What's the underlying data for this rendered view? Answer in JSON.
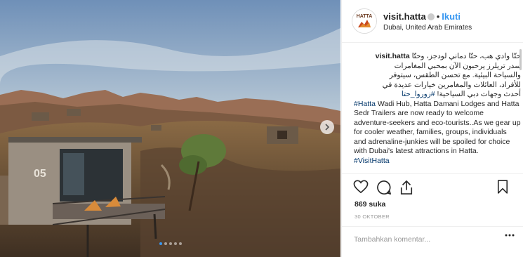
{
  "photo": {
    "alt_icon": "photo-carousel",
    "sign_number": "05",
    "dots_count": 5,
    "active_dot": 0
  },
  "header": {
    "username": "visit.hatta",
    "separator": "•",
    "follow_label": "Ikuti",
    "location": "Dubai, United Arab Emirates",
    "avatar_text": "HATTA"
  },
  "caption": {
    "username": "visit.hatta",
    "arabic_line1": "حتّا وادي هب، حتّا دماني لودجز، وحتّا",
    "arabic_line2": "سدر تريلرز يرحبون الآن بمحبي المغامرات",
    "arabic_line3": "والسياحة البيئية. مع تحسن الطقس، سيتوفر",
    "arabic_line4": "للأفراد، العائلات والمغامرين خيارات عديدة في",
    "arabic_line5": "أحدث وجهات دبي السياحية!",
    "arabic_tag": "#زوروا_حتا",
    "en_tag": "#Hatta",
    "en_text": " Wadi Hub, Hatta Damani Lodges and Hatta Sedr Trailers are now ready to welcome adventure-seekers and eco-tourists..As we gear up for cooler weather, families, groups, individuals and adrenaline-junkies will be spoiled for choice with Dubai's latest attractions in Hatta.",
    "en_tag2": "#VisitHatta"
  },
  "stats": {
    "likes": "869 suka",
    "date": "30 OKTOBER"
  },
  "comment": {
    "placeholder": "Tambahkan komentar..."
  },
  "colors": {
    "link_blue": "#3897f0",
    "hashtag": "#003569",
    "text": "#262626",
    "muted": "#999999"
  }
}
